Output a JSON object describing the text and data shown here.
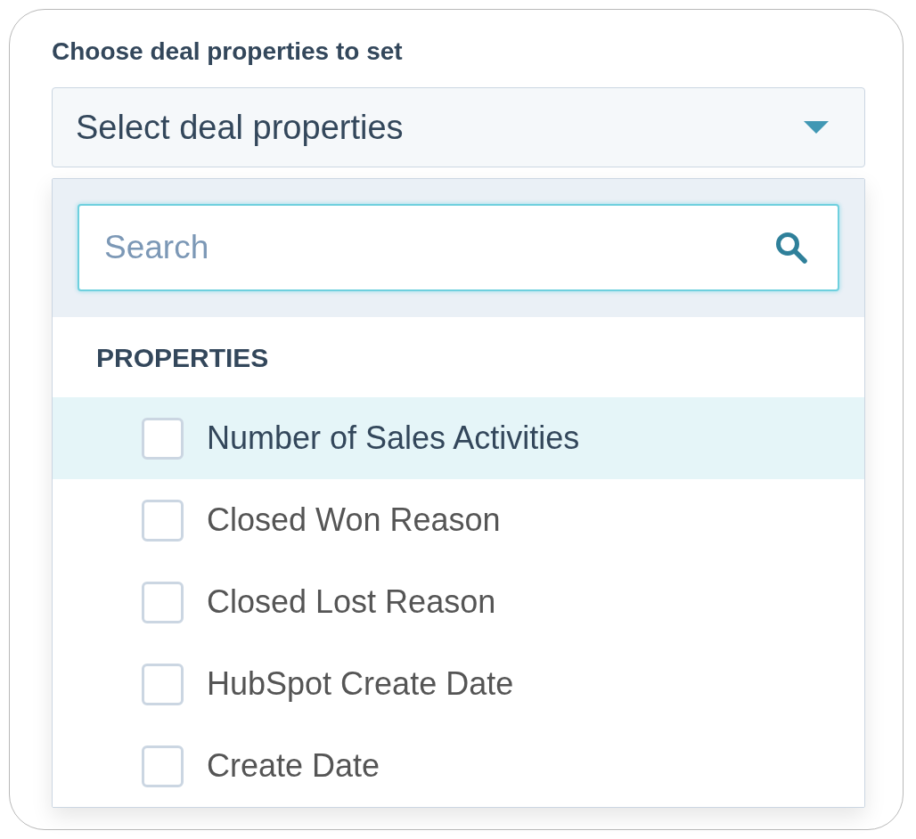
{
  "field": {
    "label": "Choose deal properties to set",
    "placeholder": "Select deal properties",
    "expanded": true
  },
  "dropdown": {
    "search": {
      "placeholder": "Search"
    },
    "section": "PROPERTIES",
    "options": [
      {
        "label": "Number of Sales Activities",
        "checked": false,
        "selected": true
      },
      {
        "label": "Closed Won Reason",
        "checked": false,
        "selected": false
      },
      {
        "label": "Closed Lost Reason",
        "checked": false,
        "selected": false
      },
      {
        "label": "HubSpot Create Date",
        "checked": false,
        "selected": false
      },
      {
        "label": "Create Date",
        "checked": false,
        "selected": false
      }
    ]
  }
}
